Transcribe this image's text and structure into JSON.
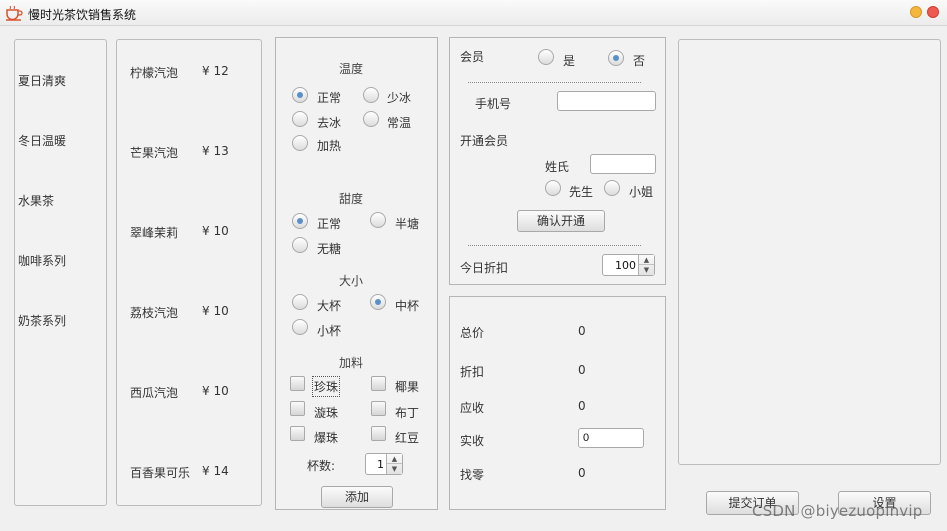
{
  "window": {
    "title": "慢时光茶饮销售系统",
    "app_icon": "tea-cup-icon"
  },
  "categories": [
    "夏日清爽",
    "冬日温暖",
    "水果茶",
    "咖啡系列",
    "奶茶系列"
  ],
  "products": [
    {
      "name": "柠檬汽泡",
      "price": "¥ 12"
    },
    {
      "name": "芒果汽泡",
      "price": "¥ 13"
    },
    {
      "name": "翠峰茉莉",
      "price": "¥ 10"
    },
    {
      "name": "荔枝汽泡",
      "price": "¥ 10"
    },
    {
      "name": "西瓜汽泡",
      "price": "¥ 10"
    },
    {
      "name": "百香果可乐",
      "price": "¥ 14"
    }
  ],
  "options": {
    "temperature": {
      "title": "温度",
      "choices": [
        "正常",
        "少冰",
        "去冰",
        "常温",
        "加热"
      ],
      "selected": "正常"
    },
    "sweetness": {
      "title": "甜度",
      "choices": [
        "正常",
        "半塘",
        "无糖"
      ],
      "selected": "正常"
    },
    "size": {
      "title": "大小",
      "choices": [
        "大杯",
        "中杯",
        "小杯"
      ],
      "selected": "中杯"
    },
    "toppings": {
      "title": "加料",
      "choices": [
        "珍珠",
        "椰果",
        "漩珠",
        "布丁",
        "爆珠",
        "红豆"
      ],
      "checked": []
    },
    "cups_label": "杯数:",
    "cups_value": "1",
    "add_button": "添加"
  },
  "member": {
    "label": "会员",
    "yes": "是",
    "no": "否",
    "selected": "否",
    "phone_label": "手机号",
    "phone_value": "",
    "open_label": "开通会员",
    "surname_label": "姓氏",
    "surname_value": "",
    "mr": "先生",
    "ms": "小姐",
    "confirm_button": "确认开通",
    "discount_label": "今日折扣",
    "discount_value": "100"
  },
  "summary": {
    "total_label": "总价",
    "total": "0",
    "discount_label": "折扣",
    "discount": "0",
    "due_label": "应收",
    "due": "0",
    "paid_label": "实收",
    "paid": "0",
    "change_label": "找零",
    "change": "0"
  },
  "actions": {
    "submit": "提交订单",
    "settings": "设置"
  },
  "watermark": "CSDN @biyezuopinvip",
  "colors": {
    "radio_dot": "#5b8fc7",
    "window_min": "#f5b63d",
    "window_close": "#ef5a4f"
  }
}
